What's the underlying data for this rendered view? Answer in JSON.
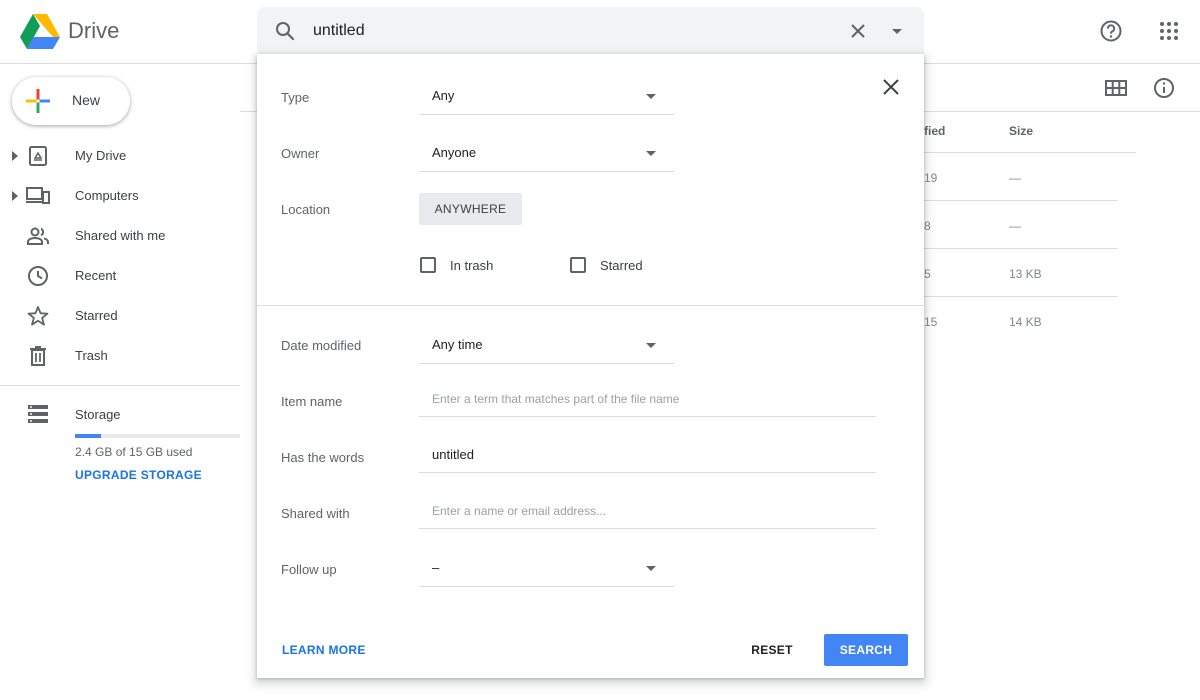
{
  "app": {
    "title": "Drive"
  },
  "search": {
    "query": "untitled"
  },
  "sidebar": {
    "new_label": "New",
    "items": [
      {
        "label": "My Drive"
      },
      {
        "label": "Computers"
      },
      {
        "label": "Shared with me"
      },
      {
        "label": "Recent"
      },
      {
        "label": "Starred"
      },
      {
        "label": "Trash"
      }
    ],
    "storage": {
      "label": "Storage",
      "used_text": "2.4 GB of 15 GB used",
      "used_fraction": 0.16,
      "upgrade_label": "UPGRADE STORAGE"
    }
  },
  "file_list": {
    "columns": [
      "fied",
      "Size"
    ],
    "rows": [
      {
        "modified": "19",
        "size": "—"
      },
      {
        "modified": "8",
        "size": "—"
      },
      {
        "modified": "5",
        "size": "13 KB"
      },
      {
        "modified": "15",
        "size": "14 KB"
      }
    ]
  },
  "advanced_search": {
    "type": {
      "label": "Type",
      "value": "Any"
    },
    "owner": {
      "label": "Owner",
      "value": "Anyone"
    },
    "location": {
      "label": "Location",
      "button": "ANYWHERE"
    },
    "in_trash": {
      "label": "In trash",
      "checked": false
    },
    "starred": {
      "label": "Starred",
      "checked": false
    },
    "date_modified": {
      "label": "Date modified",
      "value": "Any time"
    },
    "item_name": {
      "label": "Item name",
      "value": "",
      "placeholder": "Enter a term that matches part of the file name"
    },
    "has_words": {
      "label": "Has the words",
      "value": "untitled"
    },
    "shared_with": {
      "label": "Shared with",
      "value": "",
      "placeholder": "Enter a name or email address..."
    },
    "follow_up": {
      "label": "Follow up",
      "value": "–"
    },
    "learn_more": "LEARN MORE",
    "reset": "RESET",
    "search": "SEARCH"
  },
  "colors": {
    "accent": "#1a73e8",
    "primary_button": "#4285f4"
  }
}
